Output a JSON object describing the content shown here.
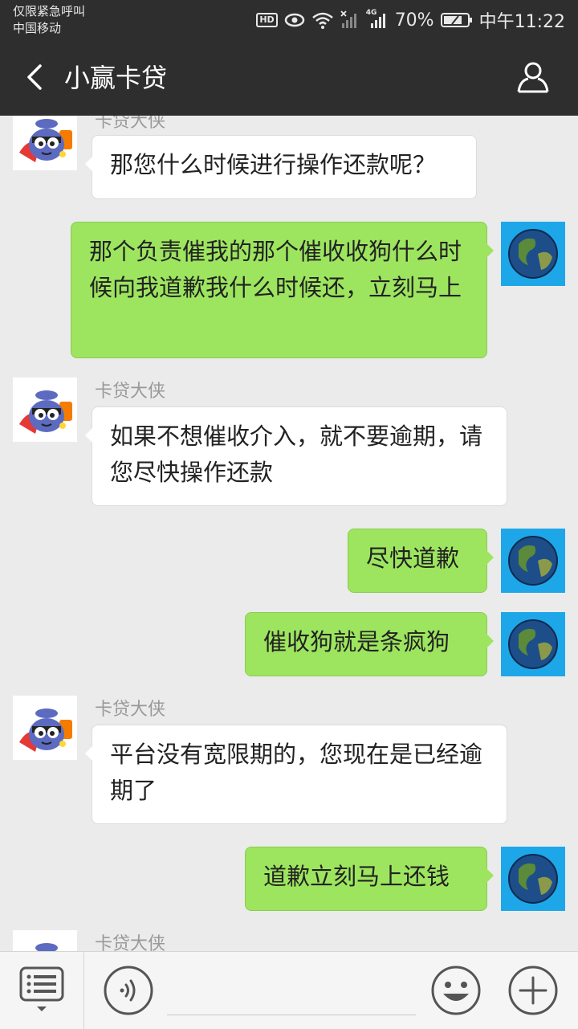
{
  "status_bar": {
    "line1": "仅限紧急呼叫",
    "line2": "中国移动",
    "hd": "HD",
    "network": "4G",
    "battery": "70%",
    "time": "中午11:22"
  },
  "header": {
    "title": "小赢卡贷",
    "back_icon": "chevron-left-icon",
    "profile_icon": "person-icon"
  },
  "messages": [
    {
      "side": "left",
      "sender": "卡贷大侠",
      "text": "那您什么时候进行操作还款呢？"
    },
    {
      "side": "right",
      "text": "那个负责催我的那个催收收狗什么时候向我道歉我什么时候还，立刻马上"
    },
    {
      "side": "left",
      "sender": "卡贷大侠",
      "text": "如果不想催收介入，就不要逾期，请您尽快操作还款"
    },
    {
      "side": "right",
      "text": "尽快道歉"
    },
    {
      "side": "right",
      "text": "催收狗就是条疯狗"
    },
    {
      "side": "left",
      "sender": "卡贷大侠",
      "text": "平台没有宽限期的，您现在是已经逾期了"
    },
    {
      "side": "right",
      "text": "道歉立刻马上还钱"
    },
    {
      "side": "left",
      "sender": "卡贷大侠",
      "text": ""
    }
  ],
  "input_bar": {
    "menu_icon": "list-menu-icon",
    "voice_icon": "voice-icon",
    "emoji_icon": "smiley-icon",
    "plus_icon": "plus-icon"
  },
  "colors": {
    "header_bg": "#2e2e2e",
    "chat_bg": "#ebebeb",
    "bubble_self": "#9de55f",
    "bubble_other": "#ffffff"
  }
}
